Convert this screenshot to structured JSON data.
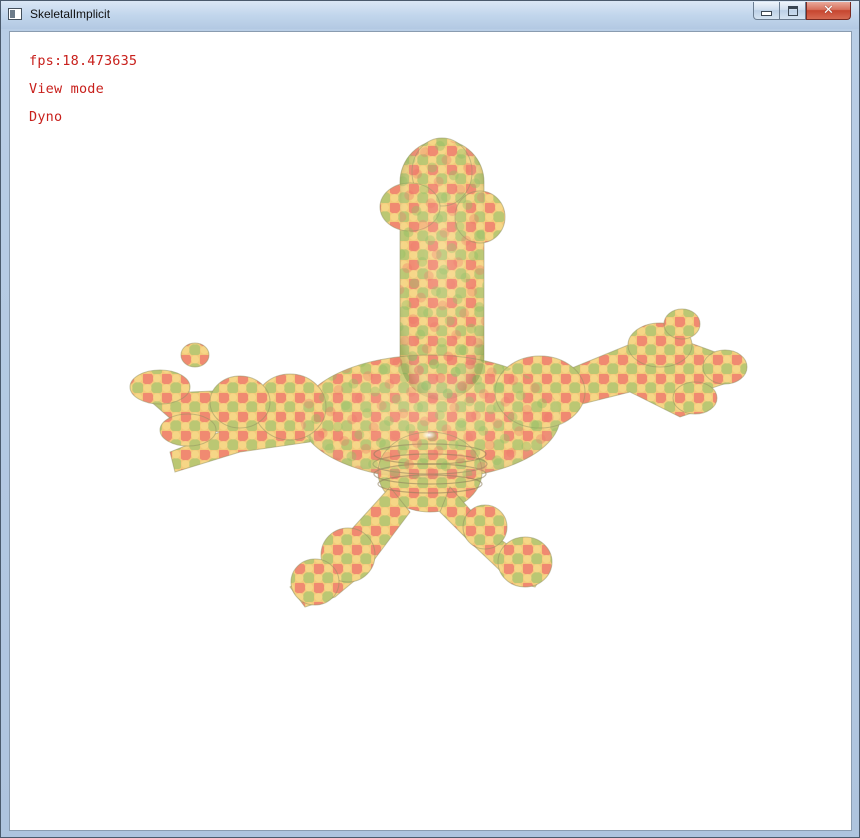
{
  "window": {
    "title": "SkeletalImplicit",
    "icon": "app-window-icon",
    "controls": {
      "minimize_icon": "minimize-icon",
      "maximize_icon": "maximize-icon",
      "close_glyph": "✕"
    }
  },
  "overlay": {
    "fps": "fps:18.473635",
    "mode": "View mode",
    "scene": "Dyno"
  },
  "colors": {
    "hud_text": "#c8201c",
    "viewport_bg": "#ffffff",
    "surface_red": "#f07a6a",
    "surface_green": "#9cc46a",
    "surface_yellow": "#f4d27a"
  }
}
